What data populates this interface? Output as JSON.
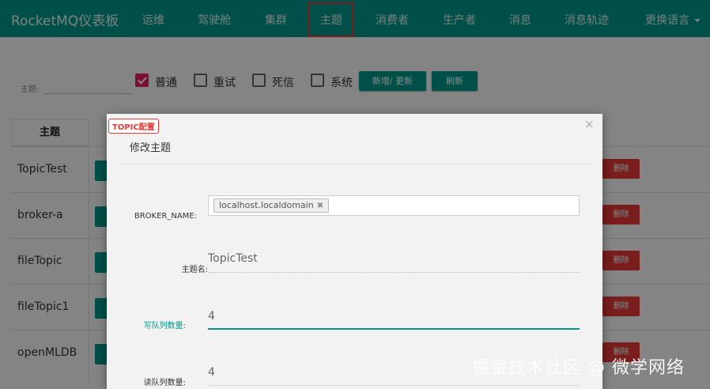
{
  "navbar": {
    "brand": "RocketMQ仪表板",
    "items": [
      "运维",
      "驾驶舱",
      "集群",
      "主题",
      "消费者",
      "生产者",
      "消息",
      "消息轨迹"
    ],
    "language": "更换语言",
    "active_item": "主题",
    "background_color": "#009688"
  },
  "filter": {
    "topic_label": "主题:",
    "checkboxes": [
      {
        "label": "普通",
        "checked": true
      },
      {
        "label": "重试",
        "checked": false
      },
      {
        "label": "死信",
        "checked": false
      },
      {
        "label": "系统",
        "checked": false
      }
    ],
    "add_update_button": "新增/ 更新",
    "refresh_button": "刷新"
  },
  "table": {
    "header": "主题",
    "rows": [
      "TopicTest",
      "broker-a",
      "fileTopic",
      "fileTopic1",
      "openMLDB"
    ],
    "delete_label": "删除"
  },
  "modal": {
    "badge": "TOPIC配置",
    "title": "修改主题",
    "close_icon": "×",
    "fields": {
      "broker_name_label": "BROKER_NAME:",
      "broker_chip": "localhost.localdomain",
      "topic_name_label": "主题名:",
      "topic_name_value": "TopicTest",
      "write_queue_label": "写队列数量:",
      "write_queue_value": "4",
      "read_queue_label": "读队列数量:",
      "read_queue_value": "4"
    }
  },
  "watermark": "掘金技术社区 @ 微学网络"
}
